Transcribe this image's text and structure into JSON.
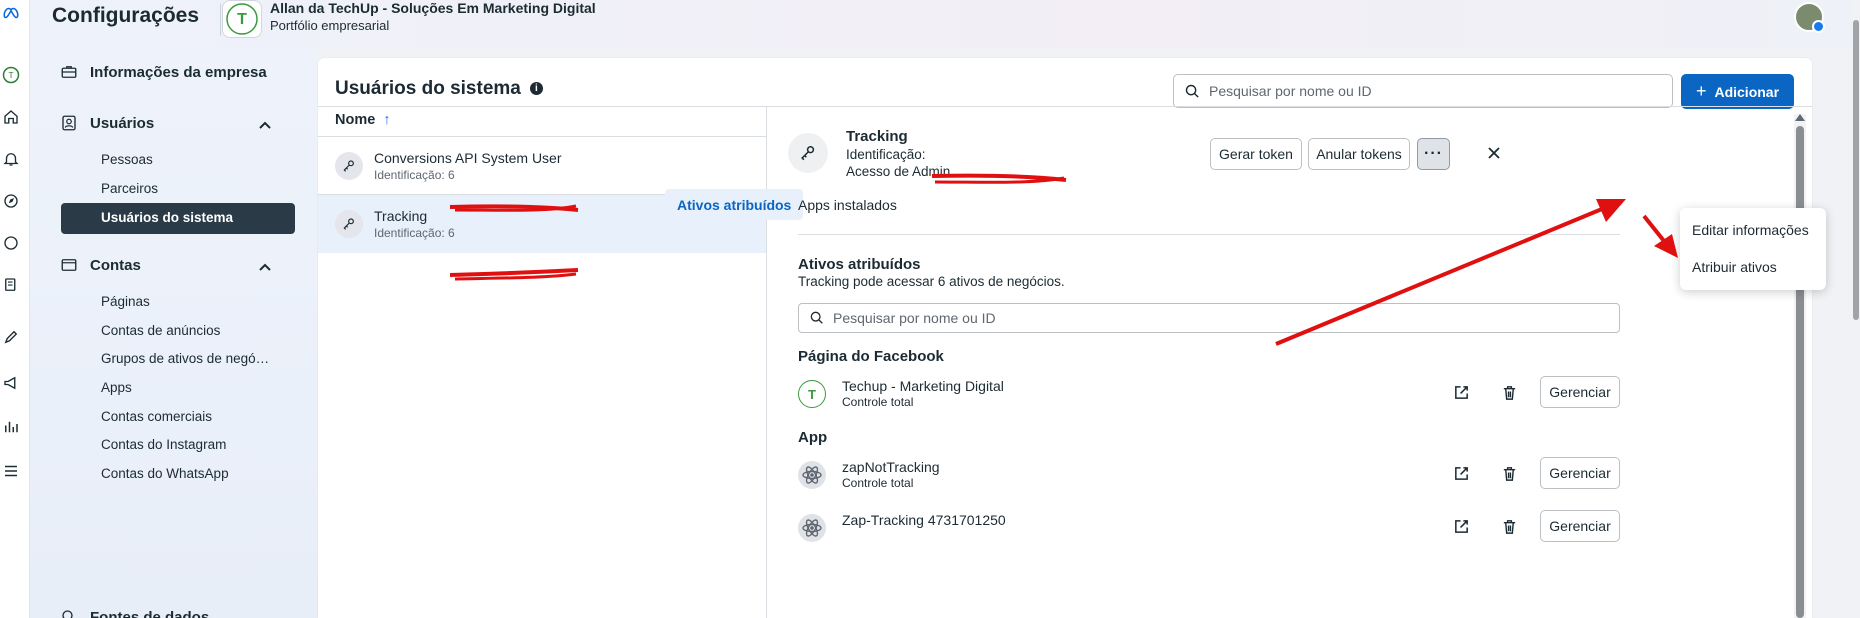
{
  "header": {
    "app_title": "Configurações",
    "business_name": "Allan da TechUp - Soluções Em Marketing Digital",
    "business_type": "Portfólio empresarial"
  },
  "nav": {
    "company_info": "Informações da empresa",
    "users": {
      "label": "Usuários",
      "items": [
        "Pessoas",
        "Parceiros",
        "Usuários do sistema"
      ]
    },
    "accounts": {
      "label": "Contas",
      "items": [
        "Páginas",
        "Contas de anúncios",
        "Grupos de ativos de negó…",
        "Apps",
        "Contas comerciais",
        "Contas do Instagram",
        "Contas do WhatsApp"
      ]
    },
    "data_sources": "Fontes de dados"
  },
  "main": {
    "title": "Usuários do sistema",
    "search_placeholder": "Pesquisar por nome ou ID",
    "add_button": "Adicionar",
    "list_header": "Nome",
    "users": [
      {
        "name": "Conversions API System User",
        "id_label": "Identificação: 6"
      },
      {
        "name": "Tracking",
        "id_label": "Identificação: 6"
      }
    ]
  },
  "detail": {
    "name": "Tracking",
    "id_label": "Identificação:",
    "access": "Acesso de Admin",
    "generate_token": "Gerar token",
    "revoke_tokens": "Anular tokens",
    "more_label": "···",
    "tabs": [
      "Ativos atribuídos",
      "Apps instalados"
    ],
    "section_title": "Ativos atribuídos",
    "section_sub": "Tracking pode acessar 6 ativos de negócios.",
    "search_placeholder": "Pesquisar por nome ou ID",
    "groups": [
      {
        "title": "Página do Facebook",
        "assets": [
          {
            "name": "Techup - Marketing Digital",
            "perm": "Controle total"
          }
        ]
      },
      {
        "title": "App",
        "assets": [
          {
            "name": "zapNotTracking",
            "perm": "Controle total"
          },
          {
            "name": "Zap-Tracking 4731701250",
            "perm": ""
          }
        ]
      }
    ],
    "manage_label": "Gerenciar"
  },
  "dropdown": {
    "items": [
      "Editar informações",
      "Atribuir ativos"
    ]
  },
  "colors": {
    "primary": "#0a66c2",
    "selected_nav": "#2a3a47",
    "annotation": "#e01010"
  }
}
